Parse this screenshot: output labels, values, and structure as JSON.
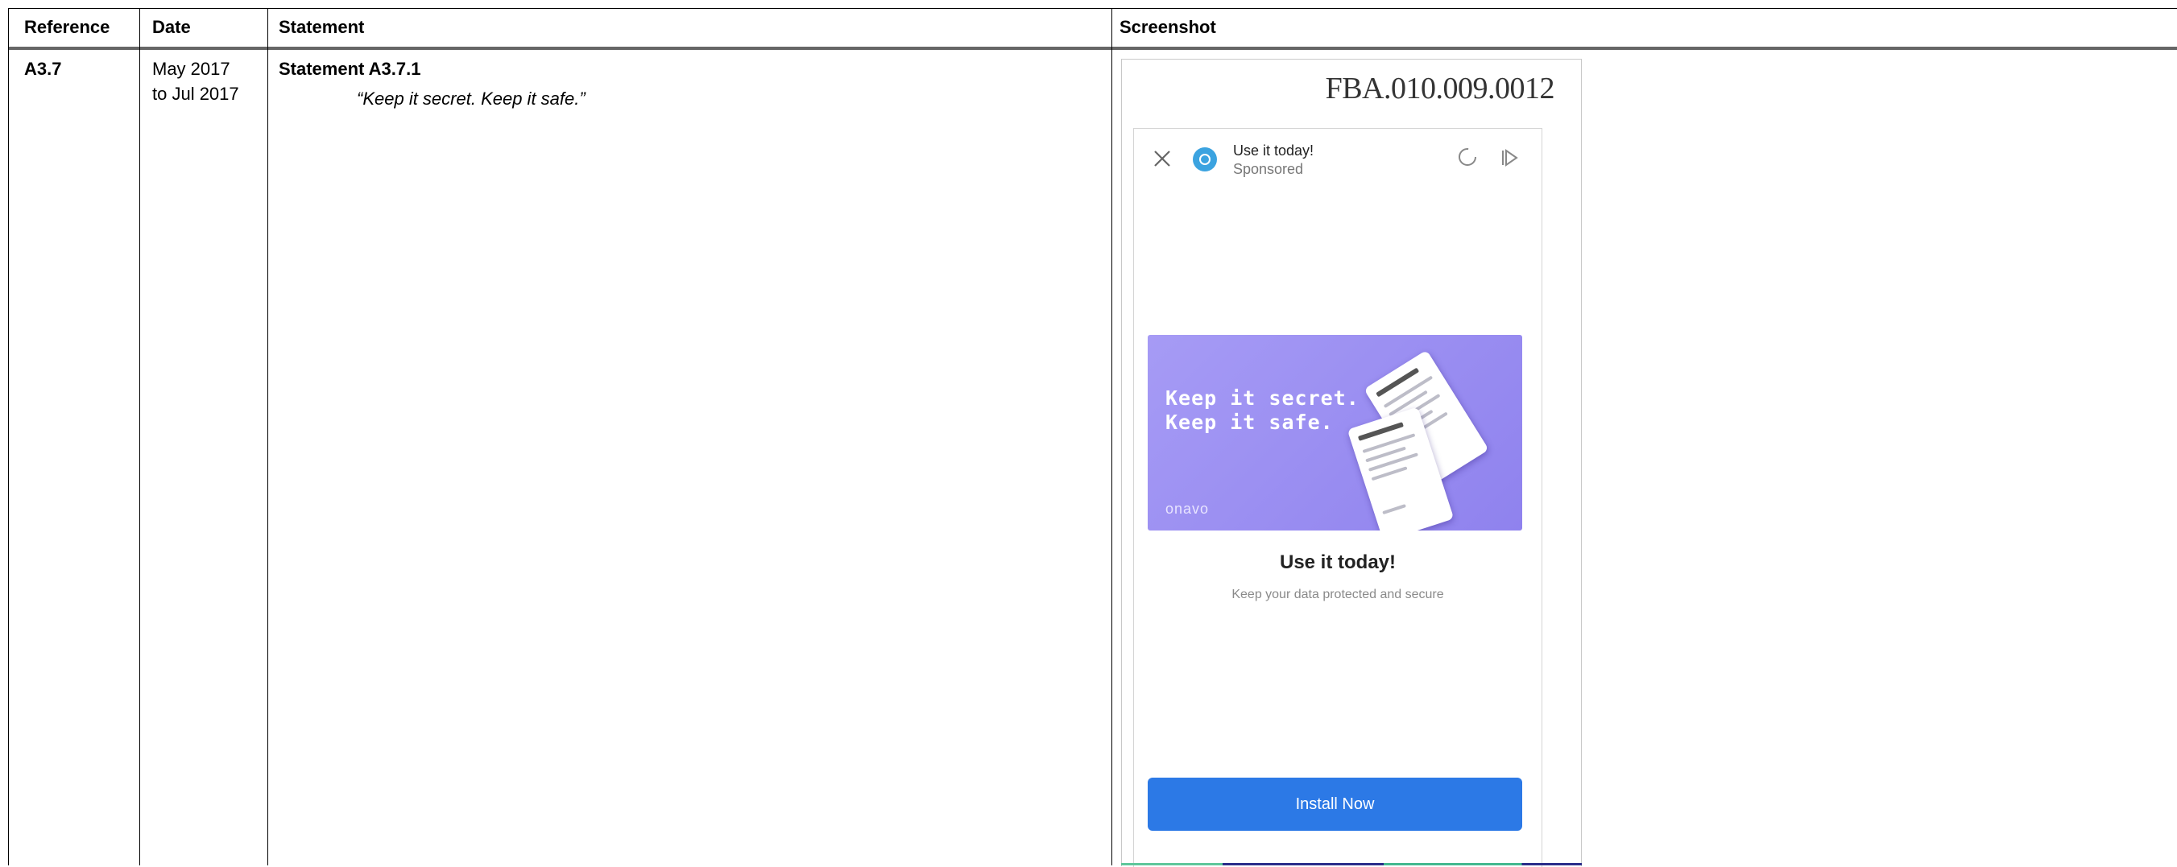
{
  "table": {
    "headers": [
      "Reference",
      "Date",
      "Statement",
      "Screenshot"
    ],
    "row": {
      "reference": "A3.7",
      "date_line1": "May 2017",
      "date_line2": "to Jul 2017",
      "statement_heading": "Statement A3.7.1",
      "statement_quote": "“Keep it secret. Keep it safe.”"
    }
  },
  "screenshot": {
    "bates_id": "FBA.010.009.0012",
    "ad": {
      "title": "Use it today!",
      "sponsored": "Sponsored",
      "banner_line1": "Keep it secret.",
      "banner_line2": "Keep it safe.",
      "banner_brand": "onavo",
      "cta_title": "Use it today!",
      "cta_description": "Keep your data protected and secure",
      "install_label": "Install Now"
    },
    "icons": [
      "close-icon",
      "brand-logo-icon",
      "timer-icon",
      "play-icon"
    ],
    "colors": {
      "banner": "#9a8ef2",
      "install_button": "#2c79e6",
      "brand_dot": "#3ba3e0"
    }
  }
}
